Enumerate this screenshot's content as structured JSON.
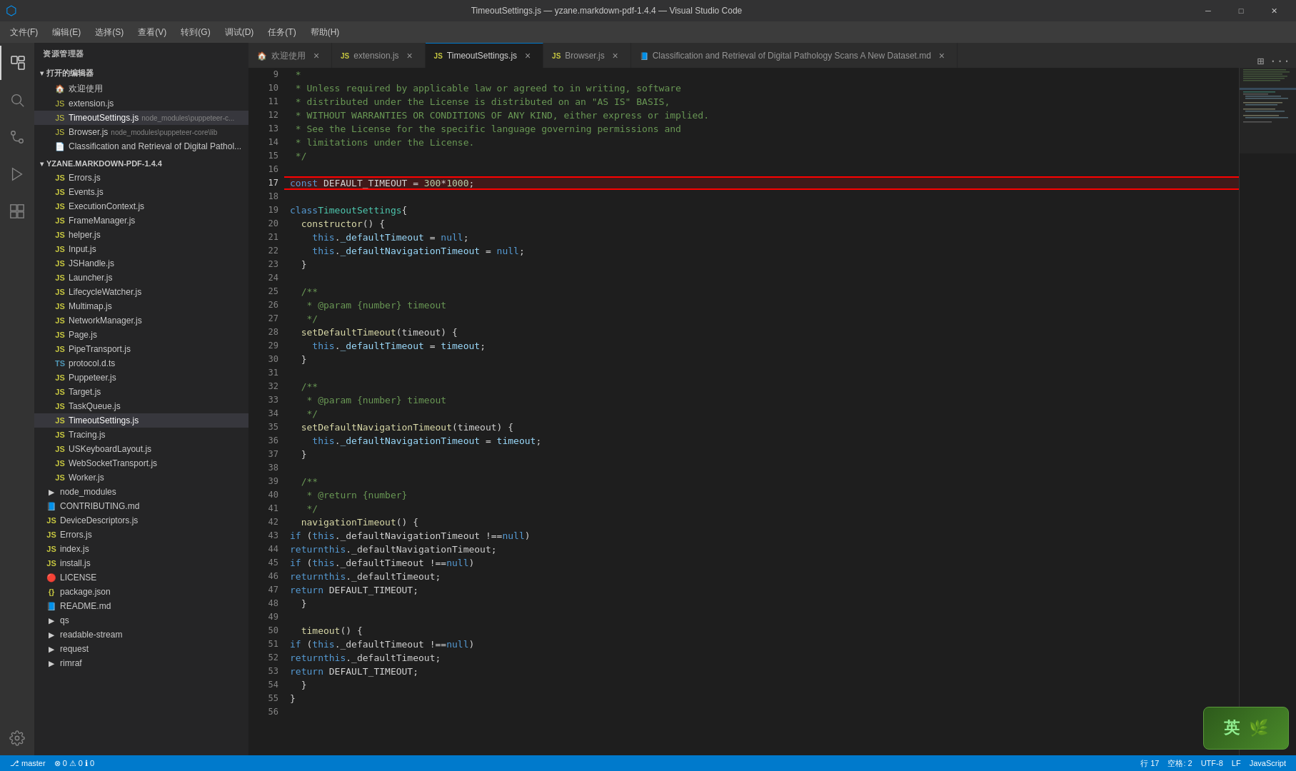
{
  "titleBar": {
    "icon": "📄",
    "title": "TimeoutSettings.js — yzane.markdown-pdf-1.4.4 — Visual Studio Code",
    "minimize": "─",
    "maximize": "□",
    "close": "✕"
  },
  "menuBar": {
    "items": [
      "文件(F)",
      "编辑(E)",
      "选择(S)",
      "查看(V)",
      "转到(G)",
      "调试(D)",
      "任务(T)",
      "帮助(H)"
    ]
  },
  "sidebar": {
    "title": "资源管理器",
    "openEditors": "打开的编辑器",
    "openFiles": [
      "欢迎使用",
      "extension.js",
      "TimeoutSettings.js",
      "Browser.js",
      "Classification and Retrieval of Digital Pathol..."
    ],
    "project": "YZANE.MARKDOWN-PDF-1.4.4",
    "files": [
      {
        "name": "Errors.js",
        "type": "js",
        "indent": 1
      },
      {
        "name": "Events.js",
        "type": "js",
        "indent": 1
      },
      {
        "name": "ExecutionContext.js",
        "type": "js",
        "indent": 1
      },
      {
        "name": "FrameManager.js",
        "type": "js",
        "indent": 1
      },
      {
        "name": "helper.js",
        "type": "js",
        "indent": 1
      },
      {
        "name": "Input.js",
        "type": "js",
        "indent": 1
      },
      {
        "name": "JSHandle.js",
        "type": "js",
        "indent": 1
      },
      {
        "name": "Launcher.js",
        "type": "js",
        "indent": 1
      },
      {
        "name": "LifecycleWatcher.js",
        "type": "js",
        "indent": 1
      },
      {
        "name": "Multimap.js",
        "type": "js",
        "indent": 1
      },
      {
        "name": "NetworkManager.js",
        "type": "js",
        "indent": 1
      },
      {
        "name": "Page.js",
        "type": "js",
        "indent": 1
      },
      {
        "name": "PipeTransport.js",
        "type": "js",
        "indent": 1
      },
      {
        "name": "protocol.d.ts",
        "type": "ts",
        "indent": 1
      },
      {
        "name": "Puppeteer.js",
        "type": "js",
        "indent": 1
      },
      {
        "name": "Target.js",
        "type": "js",
        "indent": 1
      },
      {
        "name": "TaskQueue.js",
        "type": "js",
        "indent": 1
      },
      {
        "name": "TimeoutSettings.js",
        "type": "js",
        "indent": 1,
        "active": true
      },
      {
        "name": "Tracing.js",
        "type": "js",
        "indent": 1
      },
      {
        "name": "USKeyboardLayout.js",
        "type": "js",
        "indent": 1
      },
      {
        "name": "WebSocketTransport.js",
        "type": "js",
        "indent": 1
      },
      {
        "name": "Worker.js",
        "type": "js",
        "indent": 1
      },
      {
        "name": "node_modules",
        "type": "folder",
        "indent": 0
      },
      {
        "name": "CONTRIBUTING.md",
        "type": "md",
        "indent": 0
      },
      {
        "name": "DeviceDescriptors.js",
        "type": "js",
        "indent": 0
      },
      {
        "name": "Errors.js",
        "type": "js",
        "indent": 0
      },
      {
        "name": "index.js",
        "type": "js",
        "indent": 0
      },
      {
        "name": "install.js",
        "type": "js",
        "indent": 0
      },
      {
        "name": "LICENSE",
        "type": "txt",
        "indent": 0
      },
      {
        "name": "package.json",
        "type": "json",
        "indent": 0
      },
      {
        "name": "README.md",
        "type": "md",
        "indent": 0
      },
      {
        "name": "qs",
        "type": "folder",
        "indent": 0
      },
      {
        "name": "readable-stream",
        "type": "folder",
        "indent": 0
      },
      {
        "name": "request",
        "type": "folder",
        "indent": 0
      },
      {
        "name": "rimraf",
        "type": "folder",
        "indent": 0
      }
    ]
  },
  "tabs": [
    {
      "label": "欢迎使用",
      "type": "welcome",
      "active": false
    },
    {
      "label": "extension.js",
      "type": "js",
      "active": false
    },
    {
      "label": "TimeoutSettings.js",
      "type": "js",
      "active": true,
      "modified": false
    },
    {
      "label": "Browser.js",
      "type": "js",
      "active": false
    },
    {
      "label": "Classification and Retrieval of Digital Pathology Scans A New Dataset.md",
      "type": "md",
      "active": false
    }
  ],
  "code": {
    "lines": [
      {
        "num": 9,
        "content": " *"
      },
      {
        "num": 10,
        "content": " * Unless required by applicable law or agreed to in writing, software"
      },
      {
        "num": 11,
        "content": " * distributed under the License is distributed on an \"AS IS\" BASIS,"
      },
      {
        "num": 12,
        "content": " * WITHOUT WARRANTIES OR CONDITIONS OF ANY KIND, either express or implied."
      },
      {
        "num": 13,
        "content": " * See the License for the specific language governing permissions and"
      },
      {
        "num": 14,
        "content": " * limitations under the License."
      },
      {
        "num": 15,
        "content": " */"
      },
      {
        "num": 16,
        "content": ""
      },
      {
        "num": 17,
        "content": "const DEFAULT_TIMEOUT = 300*1000;",
        "highlighted": true
      },
      {
        "num": 18,
        "content": ""
      },
      {
        "num": 19,
        "content": "class TimeoutSettings {"
      },
      {
        "num": 20,
        "content": "  constructor() {"
      },
      {
        "num": 21,
        "content": "    this._defaultTimeout = null;"
      },
      {
        "num": 22,
        "content": "    this._defaultNavigationTimeout = null;"
      },
      {
        "num": 23,
        "content": "  }"
      },
      {
        "num": 24,
        "content": ""
      },
      {
        "num": 25,
        "content": "  /**"
      },
      {
        "num": 26,
        "content": "   * @param {number} timeout"
      },
      {
        "num": 27,
        "content": "   */"
      },
      {
        "num": 28,
        "content": "  setDefaultTimeout(timeout) {"
      },
      {
        "num": 29,
        "content": "    this._defaultTimeout = timeout;"
      },
      {
        "num": 30,
        "content": "  }"
      },
      {
        "num": 31,
        "content": ""
      },
      {
        "num": 32,
        "content": "  /**"
      },
      {
        "num": 33,
        "content": "   * @param {number} timeout"
      },
      {
        "num": 34,
        "content": "   */"
      },
      {
        "num": 35,
        "content": "  setDefaultNavigationTimeout(timeout) {"
      },
      {
        "num": 36,
        "content": "    this._defaultNavigationTimeout = timeout;"
      },
      {
        "num": 37,
        "content": "  }"
      },
      {
        "num": 38,
        "content": ""
      },
      {
        "num": 39,
        "content": "  /**"
      },
      {
        "num": 40,
        "content": "   * @return {number}"
      },
      {
        "num": 41,
        "content": "   */"
      },
      {
        "num": 42,
        "content": "  navigationTimeout() {"
      },
      {
        "num": 43,
        "content": "    if (this._defaultNavigationTimeout !== null)"
      },
      {
        "num": 44,
        "content": "      return this._defaultNavigationTimeout;"
      },
      {
        "num": 45,
        "content": "    if (this._defaultTimeout !== null)"
      },
      {
        "num": 46,
        "content": "      return this._defaultTimeout;"
      },
      {
        "num": 47,
        "content": "    return DEFAULT_TIMEOUT;"
      },
      {
        "num": 48,
        "content": "  }"
      },
      {
        "num": 49,
        "content": ""
      },
      {
        "num": 50,
        "content": "  timeout() {"
      },
      {
        "num": 51,
        "content": "    if (this._defaultTimeout !== null)"
      },
      {
        "num": 52,
        "content": "      return this._defaultTimeout;"
      },
      {
        "num": 53,
        "content": "    return DEFAULT_TIMEOUT;"
      },
      {
        "num": 54,
        "content": "  }"
      },
      {
        "num": 55,
        "content": "}"
      },
      {
        "num": 56,
        "content": ""
      }
    ]
  },
  "statusBar": {
    "errors": "0",
    "warnings": "0",
    "info": "0",
    "line": "行 17",
    "encoding": "UTF-8",
    "lineEnding": "LF",
    "language": "JavaScript",
    "spaces": "空格: 2",
    "branch": "master",
    "ime": "英"
  }
}
